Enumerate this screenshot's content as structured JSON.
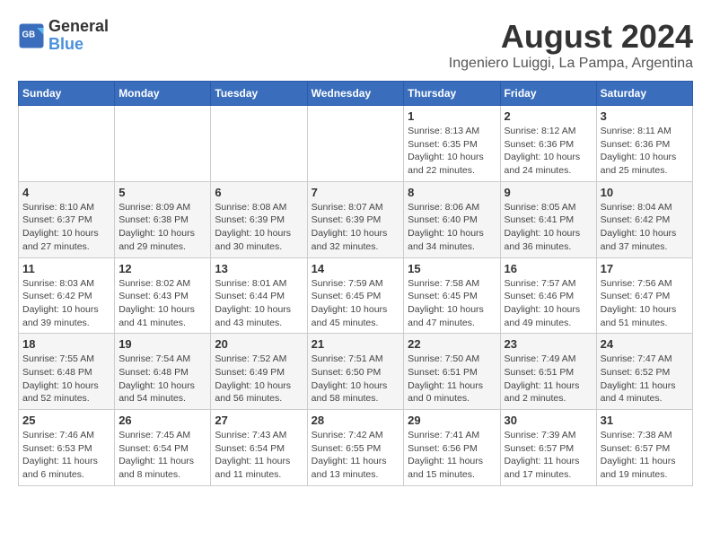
{
  "logo": {
    "text_general": "General",
    "text_blue": "Blue"
  },
  "title": "August 2024",
  "subtitle": "Ingeniero Luiggi, La Pampa, Argentina",
  "headers": [
    "Sunday",
    "Monday",
    "Tuesday",
    "Wednesday",
    "Thursday",
    "Friday",
    "Saturday"
  ],
  "weeks": [
    [
      {
        "day": "",
        "info": ""
      },
      {
        "day": "",
        "info": ""
      },
      {
        "day": "",
        "info": ""
      },
      {
        "day": "",
        "info": ""
      },
      {
        "day": "1",
        "info": "Sunrise: 8:13 AM\nSunset: 6:35 PM\nDaylight: 10 hours\nand 22 minutes."
      },
      {
        "day": "2",
        "info": "Sunrise: 8:12 AM\nSunset: 6:36 PM\nDaylight: 10 hours\nand 24 minutes."
      },
      {
        "day": "3",
        "info": "Sunrise: 8:11 AM\nSunset: 6:36 PM\nDaylight: 10 hours\nand 25 minutes."
      }
    ],
    [
      {
        "day": "4",
        "info": "Sunrise: 8:10 AM\nSunset: 6:37 PM\nDaylight: 10 hours\nand 27 minutes."
      },
      {
        "day": "5",
        "info": "Sunrise: 8:09 AM\nSunset: 6:38 PM\nDaylight: 10 hours\nand 29 minutes."
      },
      {
        "day": "6",
        "info": "Sunrise: 8:08 AM\nSunset: 6:39 PM\nDaylight: 10 hours\nand 30 minutes."
      },
      {
        "day": "7",
        "info": "Sunrise: 8:07 AM\nSunset: 6:39 PM\nDaylight: 10 hours\nand 32 minutes."
      },
      {
        "day": "8",
        "info": "Sunrise: 8:06 AM\nSunset: 6:40 PM\nDaylight: 10 hours\nand 34 minutes."
      },
      {
        "day": "9",
        "info": "Sunrise: 8:05 AM\nSunset: 6:41 PM\nDaylight: 10 hours\nand 36 minutes."
      },
      {
        "day": "10",
        "info": "Sunrise: 8:04 AM\nSunset: 6:42 PM\nDaylight: 10 hours\nand 37 minutes."
      }
    ],
    [
      {
        "day": "11",
        "info": "Sunrise: 8:03 AM\nSunset: 6:42 PM\nDaylight: 10 hours\nand 39 minutes."
      },
      {
        "day": "12",
        "info": "Sunrise: 8:02 AM\nSunset: 6:43 PM\nDaylight: 10 hours\nand 41 minutes."
      },
      {
        "day": "13",
        "info": "Sunrise: 8:01 AM\nSunset: 6:44 PM\nDaylight: 10 hours\nand 43 minutes."
      },
      {
        "day": "14",
        "info": "Sunrise: 7:59 AM\nSunset: 6:45 PM\nDaylight: 10 hours\nand 45 minutes."
      },
      {
        "day": "15",
        "info": "Sunrise: 7:58 AM\nSunset: 6:45 PM\nDaylight: 10 hours\nand 47 minutes."
      },
      {
        "day": "16",
        "info": "Sunrise: 7:57 AM\nSunset: 6:46 PM\nDaylight: 10 hours\nand 49 minutes."
      },
      {
        "day": "17",
        "info": "Sunrise: 7:56 AM\nSunset: 6:47 PM\nDaylight: 10 hours\nand 51 minutes."
      }
    ],
    [
      {
        "day": "18",
        "info": "Sunrise: 7:55 AM\nSunset: 6:48 PM\nDaylight: 10 hours\nand 52 minutes."
      },
      {
        "day": "19",
        "info": "Sunrise: 7:54 AM\nSunset: 6:48 PM\nDaylight: 10 hours\nand 54 minutes."
      },
      {
        "day": "20",
        "info": "Sunrise: 7:52 AM\nSunset: 6:49 PM\nDaylight: 10 hours\nand 56 minutes."
      },
      {
        "day": "21",
        "info": "Sunrise: 7:51 AM\nSunset: 6:50 PM\nDaylight: 10 hours\nand 58 minutes."
      },
      {
        "day": "22",
        "info": "Sunrise: 7:50 AM\nSunset: 6:51 PM\nDaylight: 11 hours\nand 0 minutes."
      },
      {
        "day": "23",
        "info": "Sunrise: 7:49 AM\nSunset: 6:51 PM\nDaylight: 11 hours\nand 2 minutes."
      },
      {
        "day": "24",
        "info": "Sunrise: 7:47 AM\nSunset: 6:52 PM\nDaylight: 11 hours\nand 4 minutes."
      }
    ],
    [
      {
        "day": "25",
        "info": "Sunrise: 7:46 AM\nSunset: 6:53 PM\nDaylight: 11 hours\nand 6 minutes."
      },
      {
        "day": "26",
        "info": "Sunrise: 7:45 AM\nSunset: 6:54 PM\nDaylight: 11 hours\nand 8 minutes."
      },
      {
        "day": "27",
        "info": "Sunrise: 7:43 AM\nSunset: 6:54 PM\nDaylight: 11 hours\nand 11 minutes."
      },
      {
        "day": "28",
        "info": "Sunrise: 7:42 AM\nSunset: 6:55 PM\nDaylight: 11 hours\nand 13 minutes."
      },
      {
        "day": "29",
        "info": "Sunrise: 7:41 AM\nSunset: 6:56 PM\nDaylight: 11 hours\nand 15 minutes."
      },
      {
        "day": "30",
        "info": "Sunrise: 7:39 AM\nSunset: 6:57 PM\nDaylight: 11 hours\nand 17 minutes."
      },
      {
        "day": "31",
        "info": "Sunrise: 7:38 AM\nSunset: 6:57 PM\nDaylight: 11 hours\nand 19 minutes."
      }
    ]
  ]
}
